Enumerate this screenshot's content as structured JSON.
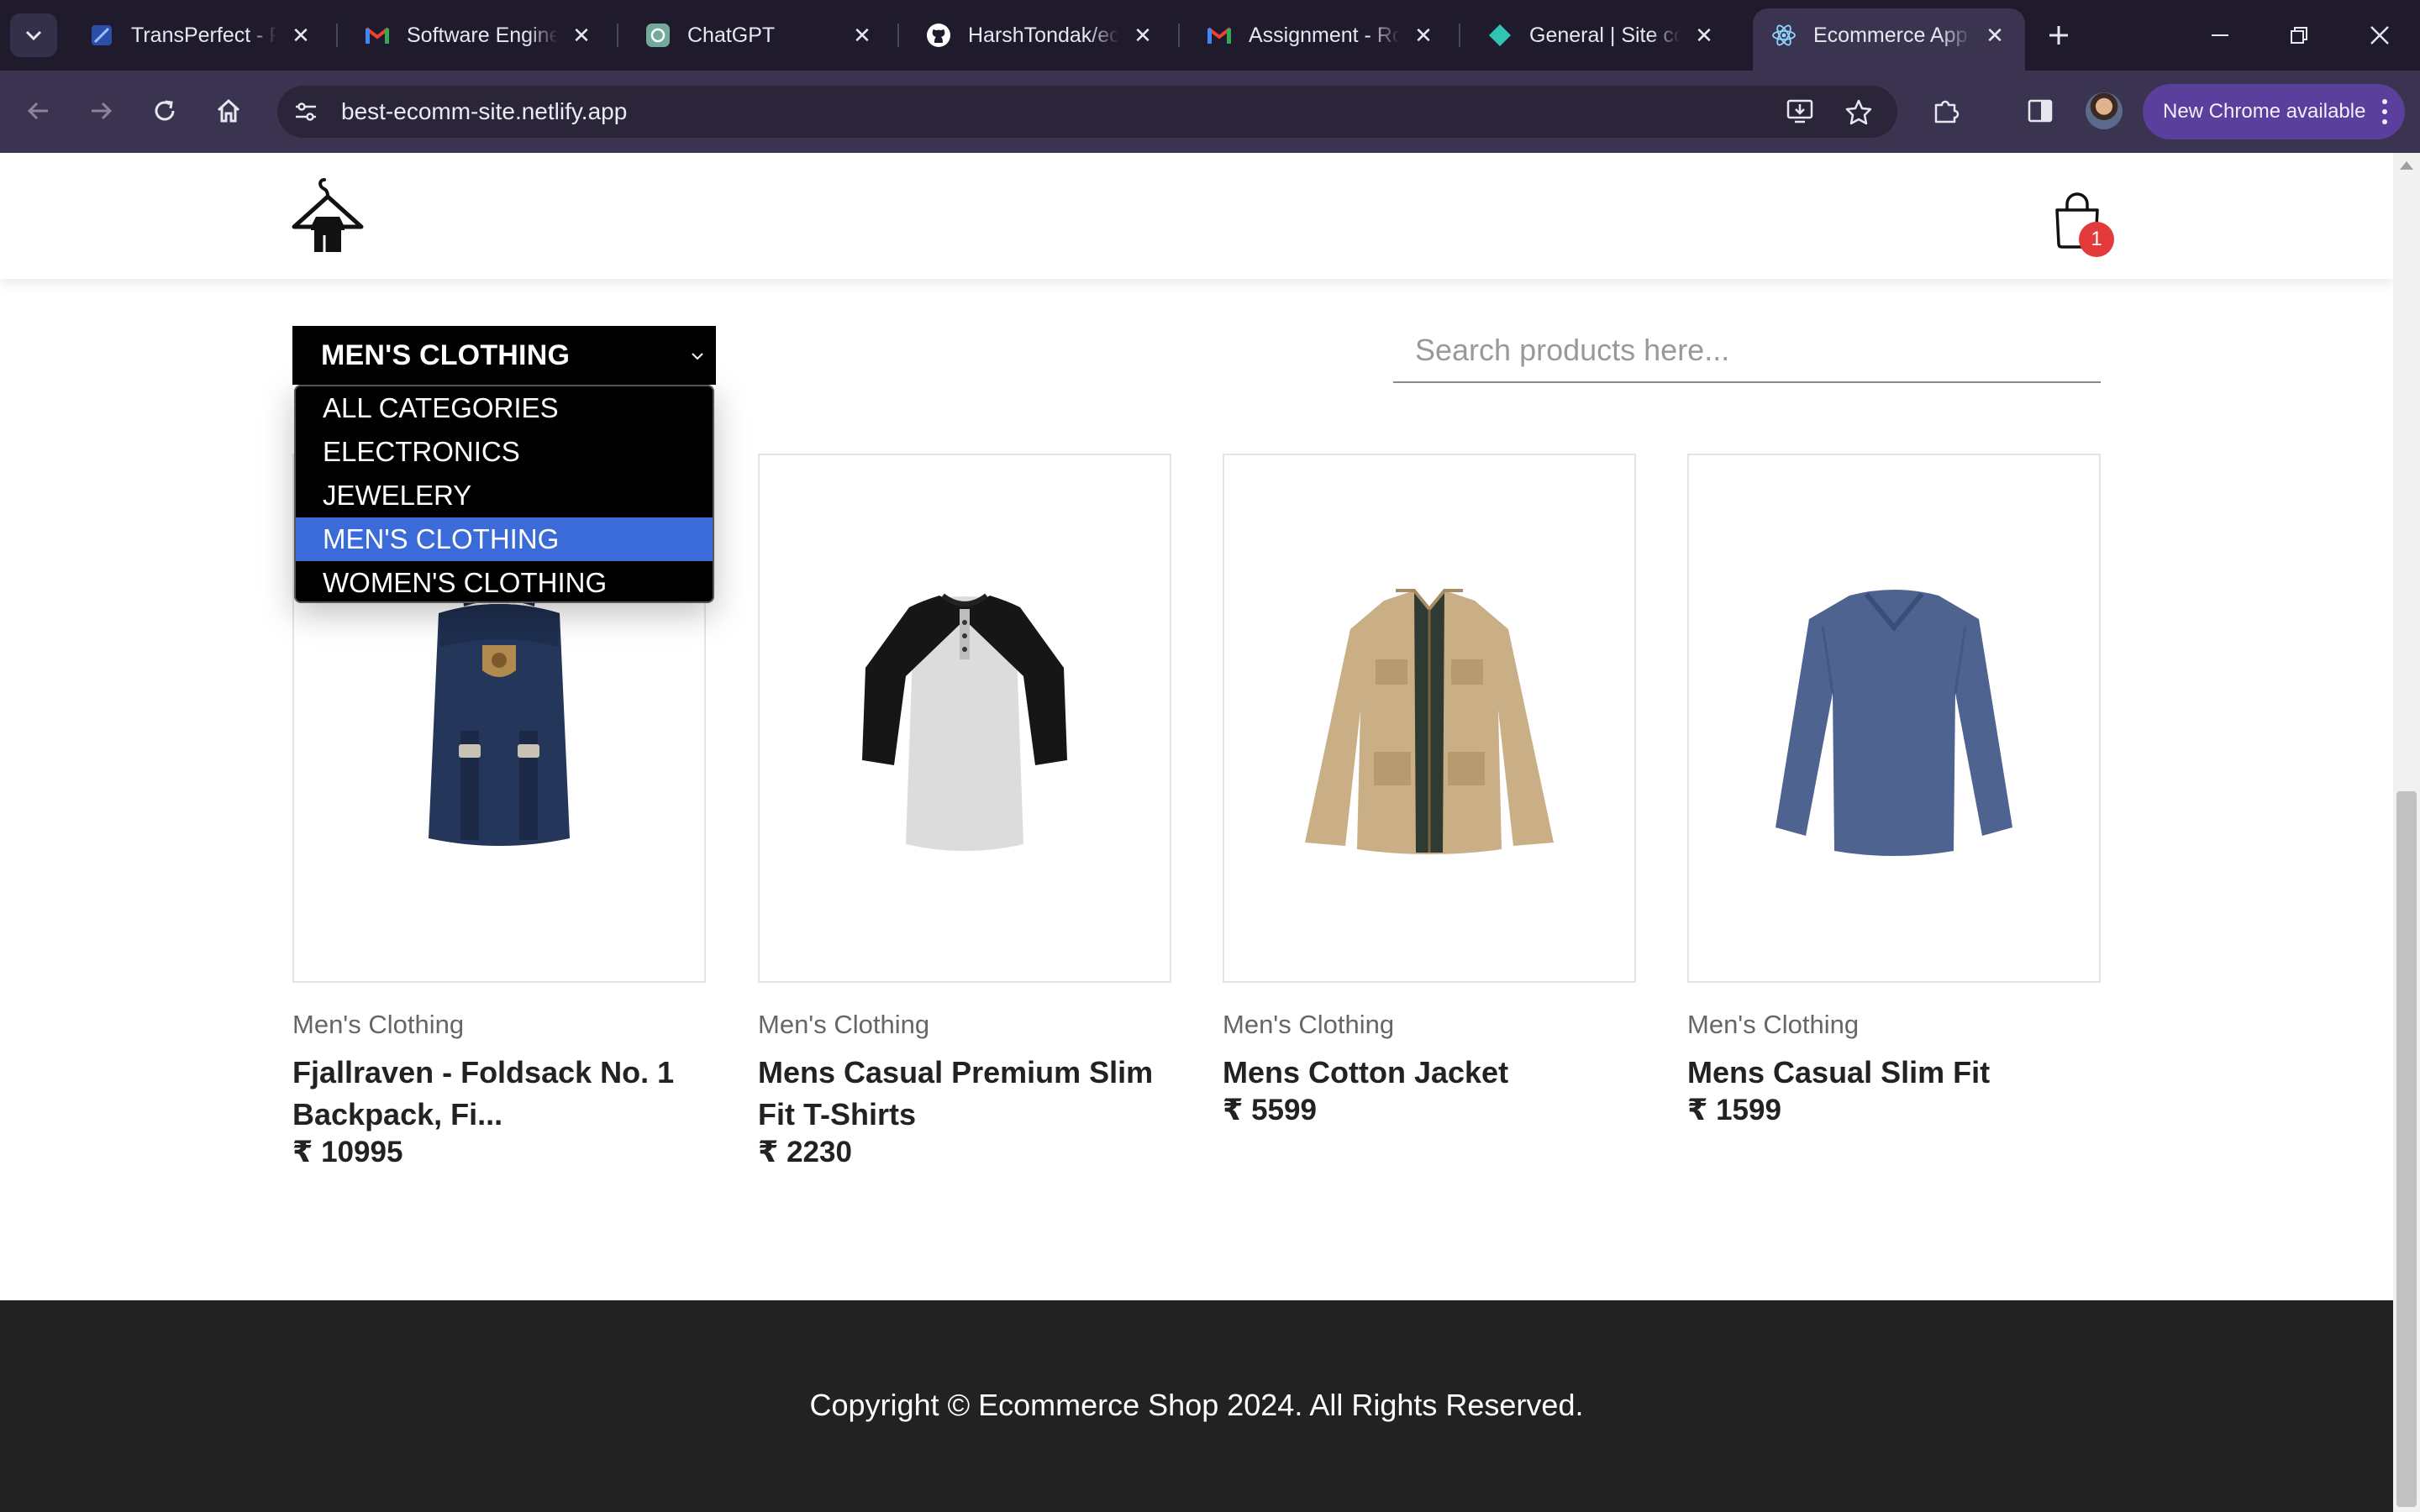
{
  "browser": {
    "tabs": [
      {
        "title": "TransPerfect - Pro",
        "icon": "transperfect-icon"
      },
      {
        "title": "Software Enginee",
        "icon": "gmail-icon"
      },
      {
        "title": "ChatGPT",
        "icon": "chatgpt-icon"
      },
      {
        "title": "HarshTondak/eco",
        "icon": "github-icon"
      },
      {
        "title": "Assignment - Rou",
        "icon": "gmail-icon"
      },
      {
        "title": "General | Site con",
        "icon": "netlify-icon"
      },
      {
        "title": "Ecommerce App",
        "icon": "react-icon",
        "active": true
      }
    ],
    "url": "best-ecomm-site.netlify.app",
    "update_label": "New Chrome available"
  },
  "colors": {
    "accent_selected": "#3b6bd8",
    "cart_badge": "#e33b3b",
    "footer_bg": "#222222",
    "update_button": "#5a3f9c"
  },
  "header": {
    "cart_count": "1"
  },
  "filters": {
    "selected_category": "MEN'S CLOTHING",
    "options": [
      "ALL CATEGORIES",
      "ELECTRONICS",
      "JEWELERY",
      "MEN'S CLOTHING",
      "WOMEN'S CLOTHING"
    ],
    "selected_index": 3,
    "search_placeholder": "Search products here..."
  },
  "products": [
    {
      "category": "Men's Clothing",
      "title": "Fjallraven - Foldsack No. 1 Backpack, Fi...",
      "price": "₹ 10995",
      "image": "backpack"
    },
    {
      "category": "Men's Clothing",
      "title": "Mens Casual Premium Slim Fit T-Shirts",
      "price": "₹ 2230",
      "image": "raglan-tshirt"
    },
    {
      "category": "Men's Clothing",
      "title": "Mens Cotton Jacket",
      "price": "₹ 5599",
      "image": "cotton-jacket"
    },
    {
      "category": "Men's Clothing",
      "title": "Mens Casual Slim Fit",
      "price": "₹ 1599",
      "image": "longsleeve-shirt"
    }
  ],
  "footer": {
    "copyright": "Copyright © Ecommerce Shop 2024. All Rights Reserved."
  }
}
